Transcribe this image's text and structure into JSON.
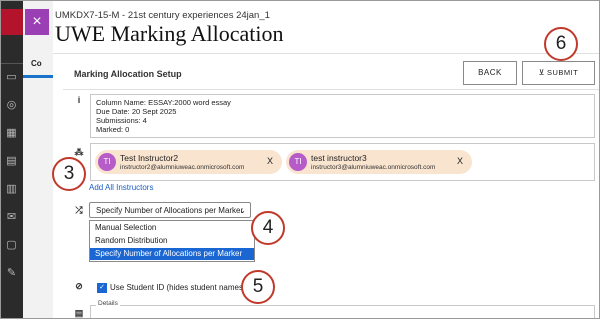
{
  "header": {
    "course": "UMKDX7-15-M - 21st century experiences 24jan_1",
    "title": "UWE Marking Allocation",
    "close_symbol": "×"
  },
  "behind": {
    "tab_label": "Co"
  },
  "setup": {
    "section_title": "Marking Allocation Setup",
    "back_label": "BACK",
    "submit_label": "SUBMIT"
  },
  "info": {
    "icon": "i",
    "lines": [
      "Column Name:   ESSAY:2000 word essay",
      "Due Date:   20 Sept 2025",
      "Submissions:   4",
      "Marked:   0"
    ]
  },
  "instructors": {
    "chips": [
      {
        "initials": "TI",
        "name": "Test Instructor2",
        "email": "instructor2@alumniuweac.onmicrosoft.com",
        "remove": "X"
      },
      {
        "initials": "TI",
        "name": "test instructor3",
        "email": "instructor3@alumniuweac.onmicrosoft.com",
        "remove": "X"
      }
    ],
    "add_all_label": "Add All Instructors"
  },
  "allocation": {
    "selected": "Specify Number of Allocations per Marker",
    "options": [
      "Manual Selection",
      "Random Distribution",
      "Specify Number of Allocations per Marker"
    ],
    "selected_index": 2
  },
  "student_id": {
    "checked": true,
    "label": "Use Student ID (hides student names)"
  },
  "details": {
    "label": "Details"
  },
  "callouts": [
    "3",
    "4",
    "5",
    "6"
  ],
  "icons": [
    "info-icon",
    "people-icon",
    "shuffle-icon",
    "eye-slash-icon",
    "document-icon",
    "close-icon",
    "submit-icon"
  ],
  "colors": {
    "accent": "#9b3fb5",
    "chip_bg": "#f9e4cf",
    "avatar": "#b65bc8",
    "link": "#1a5fc4",
    "selection": "#1a66d2",
    "callout_ring": "#c0392b"
  }
}
